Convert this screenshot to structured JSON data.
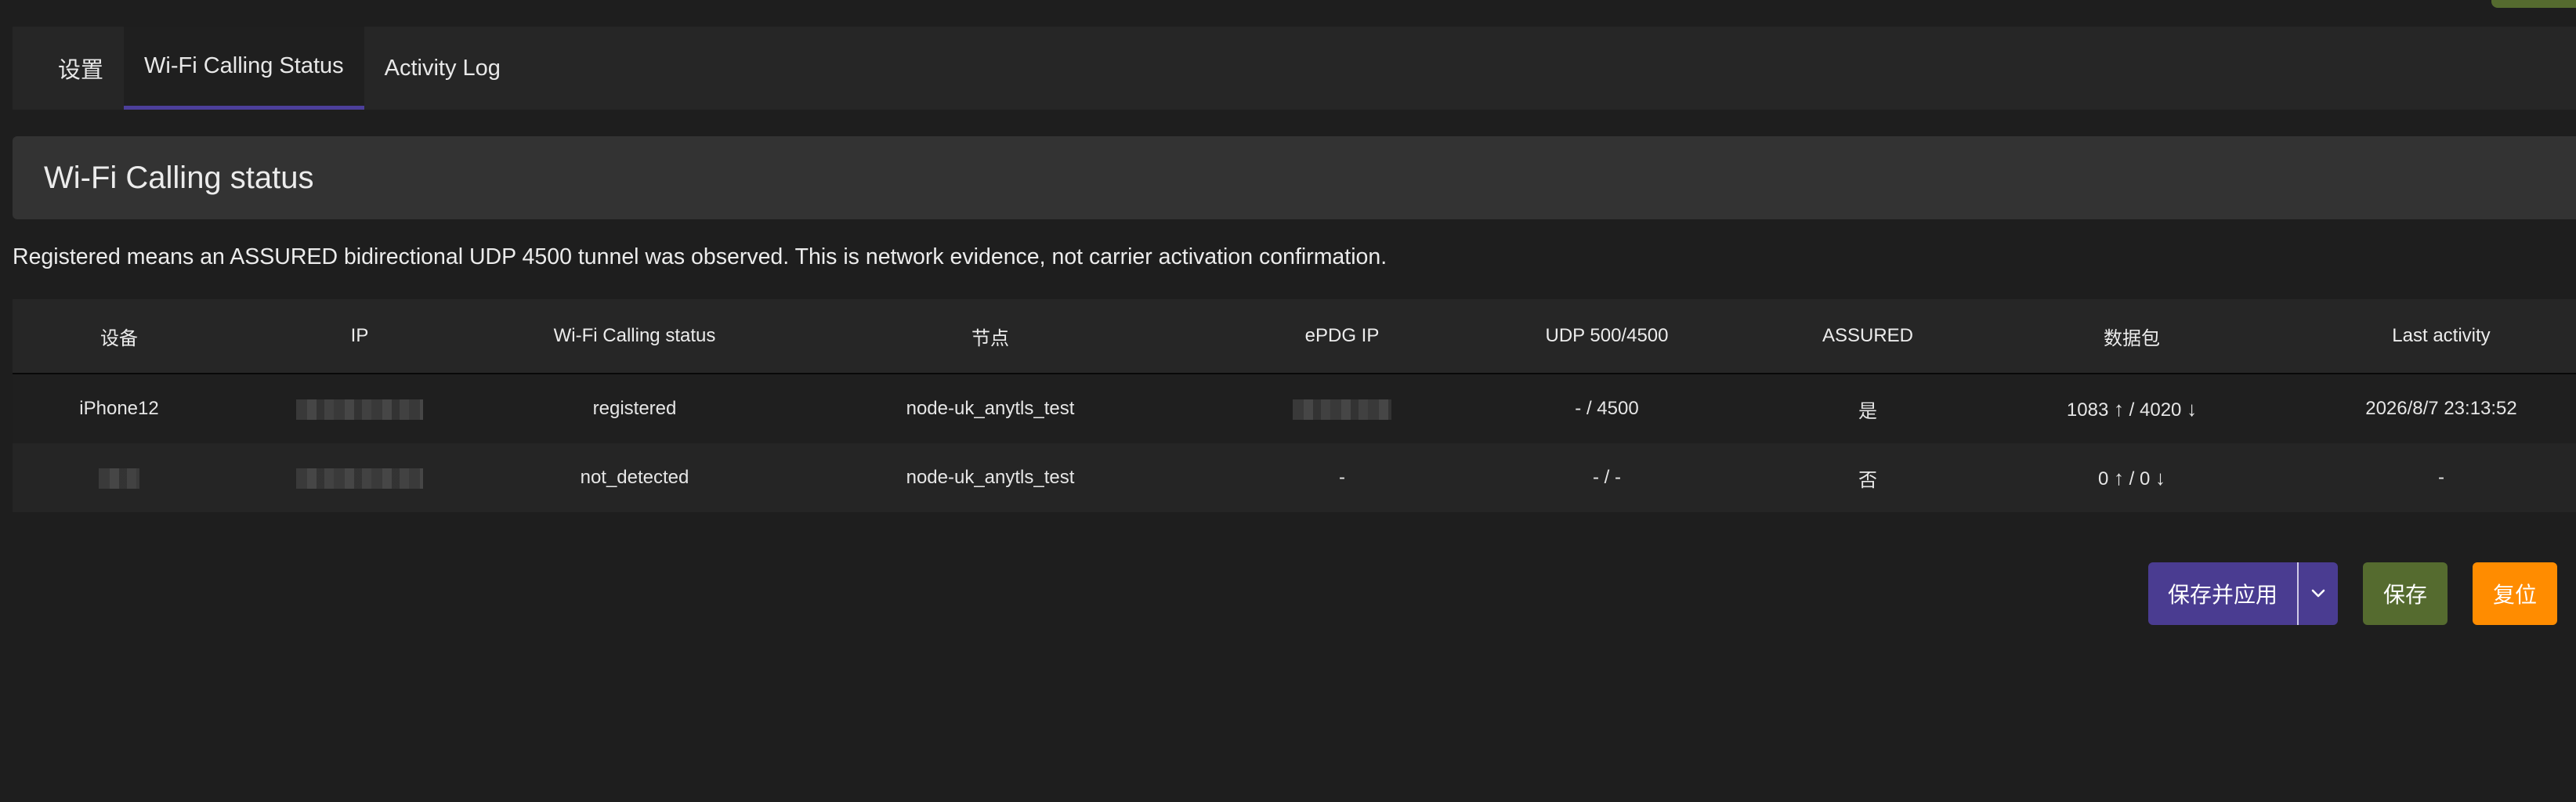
{
  "tabs": [
    {
      "label": "设置",
      "active": false
    },
    {
      "label": "Wi-Fi Calling Status",
      "active": true
    },
    {
      "label": "Activity Log",
      "active": false
    }
  ],
  "section": {
    "title": "Wi-Fi Calling status",
    "description": "Registered means an ASSURED bidirectional UDP 4500 tunnel was observed. This is network evidence, not carrier activation confirmation."
  },
  "table": {
    "headers": [
      "设备",
      "IP",
      "Wi-Fi Calling status",
      "节点",
      "ePDG IP",
      "UDP 500/4500",
      "ASSURED",
      "数据包",
      "Last activity"
    ],
    "rows": [
      {
        "device": "iPhone12",
        "ip": "",
        "status": "registered",
        "node": "node-uk_anytls_test",
        "epdg_ip": "",
        "udp": "- / 4500",
        "assured": "是",
        "packets_up": "1083",
        "packets_down": "4020",
        "last_activity": "2026/8/7 23:13:52"
      },
      {
        "device": "",
        "ip": "",
        "status": "not_detected",
        "node": "node-uk_anytls_test",
        "epdg_ip": "-",
        "udp": "- / -",
        "assured": "否",
        "packets_up": "0",
        "packets_down": "0",
        "last_activity": "-"
      }
    ]
  },
  "actions": {
    "save_apply_label": "保存并应用",
    "save_label": "保存",
    "reset_label": "复位"
  },
  "colors": {
    "accent_tab": "#4c3f9a",
    "save_apply": "#4a3c91",
    "save": "#556b2f",
    "reset": "#ff8c00"
  },
  "icons": {
    "dropdown": "chevron-down-icon",
    "up": "arrow-up-icon",
    "down": "arrow-down-icon"
  }
}
